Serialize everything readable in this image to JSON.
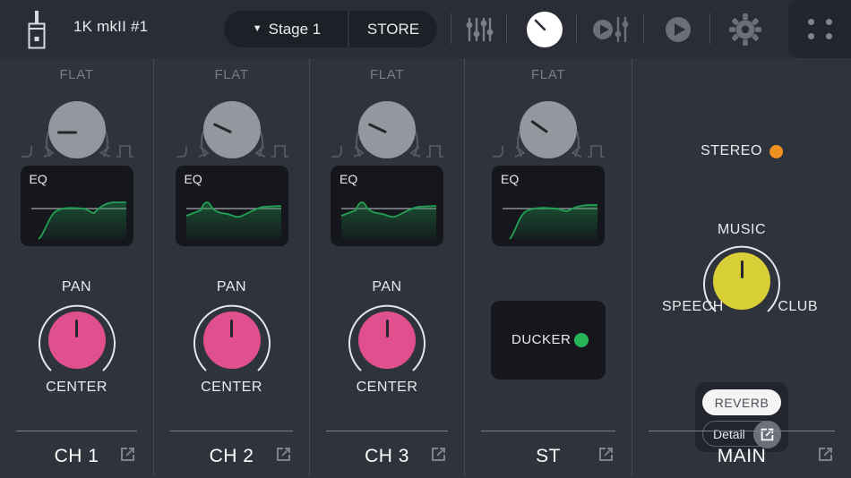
{
  "header": {
    "logo_icon": "mixer-device-icon",
    "device_name": "1K mkII #1",
    "preset_name": "Stage 1",
    "preset_caret": "▼",
    "store_label": "STORE",
    "tools": [
      {
        "name": "faders-icon",
        "active": false
      },
      {
        "name": "knob-icon",
        "active": true
      },
      {
        "name": "player-faders-icon",
        "active": false
      },
      {
        "name": "play-icon",
        "active": false
      },
      {
        "name": "gear-icon",
        "active": false
      }
    ],
    "grid_menu_icon": "grid-dots-icon"
  },
  "strips": [
    {
      "id": "ch1",
      "eq_knob_label": "FLAT",
      "eq_card_label": "EQ",
      "pan_label": "PAN",
      "pan_value": "CENTER",
      "footer_label": "CH 1",
      "footer_icon": "external-link-icon"
    },
    {
      "id": "ch2",
      "eq_knob_label": "FLAT",
      "eq_card_label": "EQ",
      "pan_label": "PAN",
      "pan_value": "CENTER",
      "footer_label": "CH 2",
      "footer_icon": "external-link-icon"
    },
    {
      "id": "ch3",
      "eq_knob_label": "FLAT",
      "eq_card_label": "EQ",
      "pan_label": "PAN",
      "pan_value": "CENTER",
      "footer_label": "CH 3",
      "footer_icon": "external-link-icon"
    },
    {
      "id": "st",
      "eq_knob_label": "FLAT",
      "eq_card_label": "EQ",
      "ducker_label": "DUCKER",
      "ducker_state": "on",
      "footer_label": "ST",
      "footer_icon": "external-link-icon"
    }
  ],
  "main": {
    "stereo_label": "STEREO",
    "stereo_led": "on",
    "mode_top": "MUSIC",
    "mode_left": "SPEECH",
    "mode_right": "CLUB",
    "reverb_label": "REVERB",
    "detail_label": "Detail",
    "detail_icon": "external-link-icon",
    "footer_label": "MAIN",
    "footer_icon": "external-link-icon"
  },
  "colors": {
    "background": "#2f333c",
    "header_bg": "#2a2d35",
    "panel_dark": "#15171d",
    "pan_knob": "#e0508f",
    "mode_knob": "#d8ce35",
    "eq_knob": "#94979e",
    "eq_curve": "#1f9a4d",
    "ducker_led": "#27b457",
    "stereo_led": "#f09120",
    "text": "#e9eaed",
    "dim_text": "#787d88"
  },
  "chart_data": [
    {
      "type": "line",
      "title": "CH 1 EQ",
      "name": "ch1-eq-curve",
      "x": [
        0,
        6,
        13,
        20,
        28,
        36,
        46,
        57,
        66,
        72,
        78,
        84,
        92,
        100
      ],
      "y": [
        0,
        10,
        33,
        49,
        55,
        56,
        56,
        55,
        50,
        55,
        62,
        64,
        64,
        64
      ],
      "ylim": [
        0,
        80
      ],
      "center_line": 56,
      "grid": false
    },
    {
      "type": "line",
      "title": "CH 2 EQ",
      "name": "ch2-eq-curve",
      "x": [
        0,
        8,
        17,
        24,
        30,
        38,
        48,
        58,
        66,
        74,
        82,
        90,
        100
      ],
      "y": [
        44,
        50,
        56,
        68,
        60,
        55,
        51,
        47,
        50,
        57,
        62,
        64,
        64
      ],
      "ylim": [
        0,
        80
      ],
      "center_line": 56,
      "grid": false
    },
    {
      "type": "line",
      "title": "CH 3 EQ",
      "name": "ch3-eq-curve",
      "x": [
        0,
        8,
        17,
        24,
        30,
        38,
        48,
        58,
        66,
        74,
        82,
        90,
        100
      ],
      "y": [
        44,
        50,
        56,
        68,
        60,
        55,
        51,
        47,
        50,
        57,
        62,
        64,
        64
      ],
      "ylim": [
        0,
        80
      ],
      "center_line": 56,
      "grid": false
    },
    {
      "type": "line",
      "title": "ST EQ",
      "name": "st-eq-curve",
      "x": [
        0,
        6,
        13,
        20,
        28,
        36,
        46,
        57,
        66,
        72,
        78,
        84,
        92,
        100
      ],
      "y": [
        0,
        10,
        33,
        49,
        55,
        56,
        56,
        55,
        52,
        55,
        60,
        62,
        62,
        62
      ],
      "ylim": [
        0,
        80
      ],
      "center_line": 56,
      "grid": false
    }
  ]
}
